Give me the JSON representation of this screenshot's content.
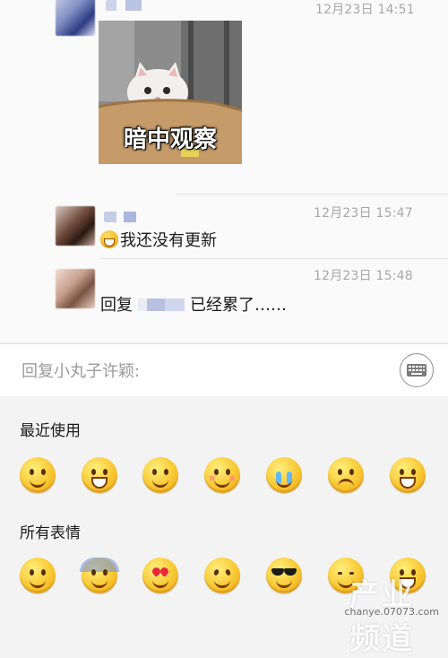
{
  "thread": {
    "messages": [
      {
        "timestamp": "12月23日 14:51",
        "sticker_caption": "暗中观察"
      },
      {
        "timestamp": "12月23日 15:47",
        "text": "我还没有更新",
        "leading_icon": "grin-emoji-icon"
      },
      {
        "timestamp": "12月23日 15:48",
        "text_prefix": "回复",
        "text_suffix": "已经累了……"
      }
    ]
  },
  "input": {
    "placeholder": "回复小丸子许颖:",
    "keyboard_icon": "keyboard-icon"
  },
  "emoji_panel": {
    "recent_title": "最近使用",
    "recent": [
      "smile-emoji-icon",
      "laugh-cry-emoji-icon",
      "smirk-emoji-icon",
      "blush-emoji-icon",
      "crying-emoji-icon",
      "sad-emoji-icon",
      "grin-emoji-icon"
    ],
    "all_title": "所有表情",
    "all": [
      "smile-emoji-icon",
      "sweat-emoji-icon",
      "heart-eyes-emoji-icon",
      "angry-emoji-icon",
      "cool-emoji-icon",
      "sleepy-emoji-icon",
      "grin-emoji-icon"
    ]
  },
  "watermark": {
    "title": "产业频道",
    "url": "chanye.07073.com"
  },
  "colors": {
    "background": "#f3f3f3",
    "thread_bg": "#fafafa",
    "timestamp": "#a7a7a7",
    "placeholder": "#9a9a9a"
  }
}
